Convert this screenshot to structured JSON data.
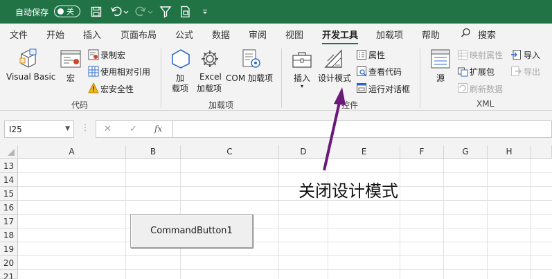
{
  "titlebar": {
    "autosave_label": "自动保存",
    "autosave_state": "关",
    "qat_icons": [
      "save-icon",
      "undo-icon",
      "redo-icon",
      "filter-icon",
      "form-icon",
      "customize-qat-icon"
    ],
    "color": "#217346"
  },
  "tabs": [
    {
      "label": "文件"
    },
    {
      "label": "开始"
    },
    {
      "label": "插入"
    },
    {
      "label": "页面布局"
    },
    {
      "label": "公式"
    },
    {
      "label": "数据"
    },
    {
      "label": "审阅"
    },
    {
      "label": "视图"
    },
    {
      "label": "开发工具",
      "active": true
    },
    {
      "label": "加载项"
    },
    {
      "label": "帮助"
    }
  ],
  "search_label": "搜索",
  "ribbon": {
    "code": {
      "visual_basic": "Visual Basic",
      "macros": "宏",
      "record_macro": "录制宏",
      "relative_refs": "使用相对引用",
      "macro_security": "宏安全性",
      "group": "代码"
    },
    "addins": {
      "addins_line1": "加",
      "addins_line2": "载项",
      "excel_line1": "Excel",
      "excel_line2": "加载项",
      "com_addins": "COM 加载项",
      "group": "加载项"
    },
    "controls": {
      "insert": "插入",
      "design_mode": "设计模式",
      "properties": "属性",
      "view_code": "查看代码",
      "run_dialog": "运行对话框",
      "group": "控件"
    },
    "xml": {
      "source": "源",
      "map_properties": "映射属性",
      "expansion_packs": "扩展包",
      "refresh_data": "刷新数据",
      "import": "导入",
      "export": "导出",
      "group": "XML"
    }
  },
  "formula_bar": {
    "name_box": "I25",
    "fx": "fx",
    "formula": ""
  },
  "columns": [
    "A",
    "B",
    "C",
    "D",
    "E",
    "F",
    "G",
    "H"
  ],
  "rows": [
    "13",
    "14",
    "15",
    "16",
    "17",
    "18",
    "19",
    "20",
    "21"
  ],
  "command_button": "CommandButton1",
  "annotation": "关闭设计模式",
  "colors": {
    "accent_green": "#217346",
    "arrow_purple": "#6b1a7a"
  }
}
